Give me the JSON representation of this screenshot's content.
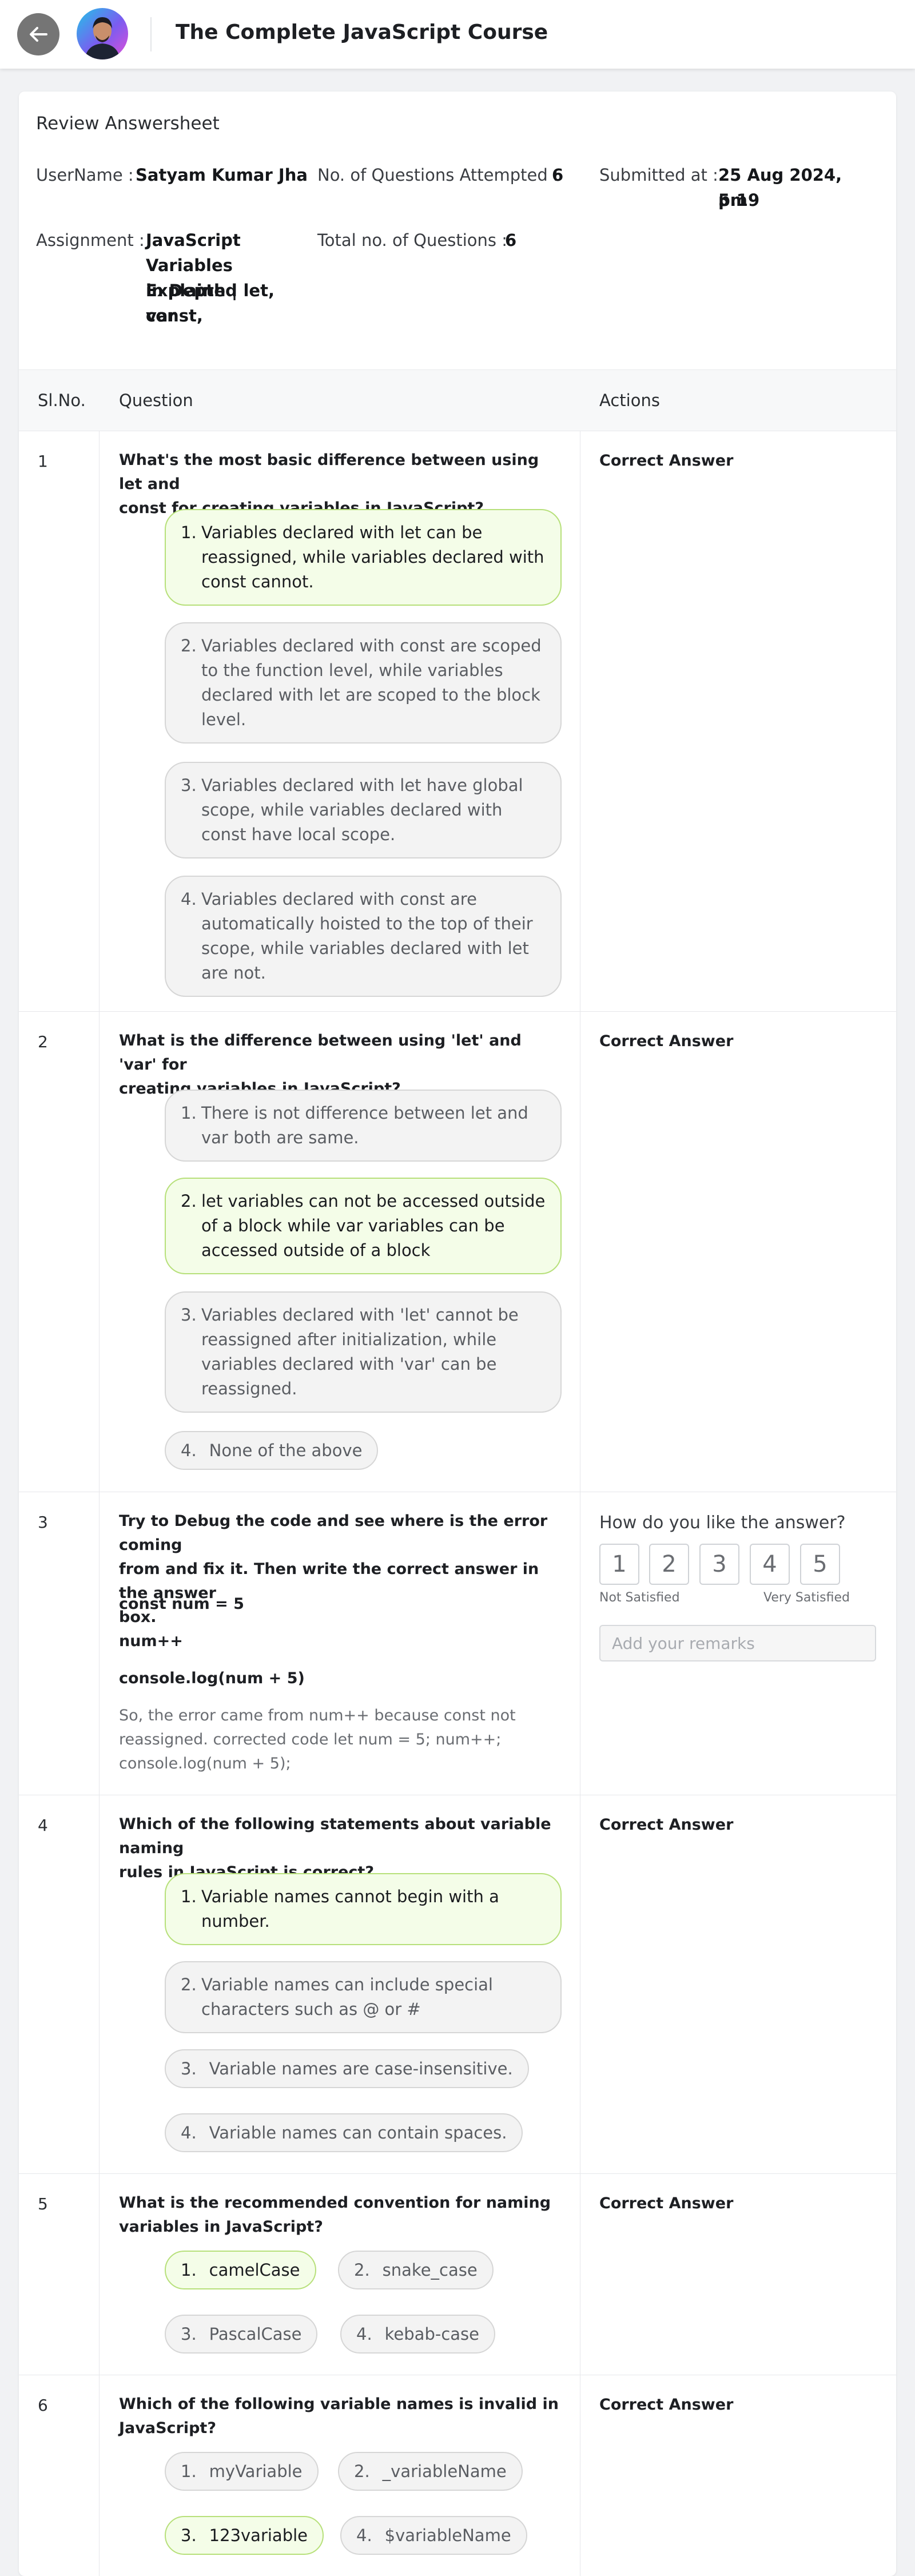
{
  "header": {
    "title": "The Complete JavaScript Course"
  },
  "review": {
    "title": "Review Answersheet",
    "username_label": "UserName :",
    "username": "Satyam Kumar Jha",
    "attempted_label": "No. of Questions Attempted :",
    "attempted": "6",
    "submitted_label": "Submitted at :",
    "submitted_line1": "25 Aug 2024, 5:19",
    "submitted_line2": "pm",
    "assignment_label": "Assignment :",
    "assignment_lines": [
      "JavaScript",
      "Variables Explained",
      "in Depth | let, const,",
      "var"
    ],
    "total_label": "Total no. of Questions :",
    "total": "6"
  },
  "table": {
    "headers": {
      "sl": "Sl.No.",
      "question": "Question",
      "actions": "Actions"
    }
  },
  "questions": [
    {
      "sl": "1",
      "lines": [
        "What's the most basic difference between using let and",
        "const for creating variables in JavaScript?"
      ],
      "action": "Correct Answer",
      "options": [
        {
          "num": "1.",
          "lines": [
            "Variables declared with let can be",
            "reassigned, while variables declared with",
            "const cannot."
          ],
          "correct": true
        },
        {
          "num": "2.",
          "lines": [
            "Variables declared with const are scoped",
            "to the function level, while variables",
            "declared with let are scoped to the block",
            "level."
          ],
          "correct": false
        },
        {
          "num": "3.",
          "lines": [
            "Variables declared with let have global",
            "scope, while variables declared with",
            "const have local scope."
          ],
          "correct": false
        },
        {
          "num": "4.",
          "lines": [
            "Variables declared with const are",
            "automatically hoisted to the top of their",
            "scope, while variables declared with let",
            "are not."
          ],
          "correct": false
        }
      ]
    },
    {
      "sl": "2",
      "lines": [
        "What is the difference between using 'let' and 'var' for",
        "creating variables in JavaScript?"
      ],
      "action": "Correct Answer",
      "options": [
        {
          "num": "1.",
          "lines": [
            "There is not difference between let and",
            "var both are same."
          ],
          "correct": false
        },
        {
          "num": "2.",
          "lines": [
            "let variables can not be accessed outside",
            "of a block while var variables can be",
            "accessed outside of a block"
          ],
          "correct": true
        },
        {
          "num": "3.",
          "lines": [
            "Variables declared with 'let' cannot be",
            "reassigned after initialization, while",
            "variables declared with 'var' can be",
            "reassigned."
          ],
          "correct": false
        },
        {
          "num": "4.",
          "lines": [
            "None of the above"
          ],
          "correct": false
        }
      ]
    },
    {
      "sl": "3",
      "lines": [
        "Try to Debug the code and see where is the error coming",
        "from and fix it. Then write the correct answer in the answer",
        "box."
      ],
      "code": [
        "const num = 5",
        "num++",
        "console.log(num + 5)"
      ],
      "answer_lines": [
        "So, the error came from num++ because const not",
        "reassigned. corrected code let num = 5; num++;",
        "console.log(num + 5);"
      ],
      "rating": {
        "title": "How do you like the answer?",
        "scale": [
          "1",
          "2",
          "3",
          "4",
          "5"
        ],
        "low": "Not Satisfied",
        "high": "Very Satisfied",
        "remarks_placeholder": "Add your remarks"
      }
    },
    {
      "sl": "4",
      "lines": [
        "Which of the following statements about variable naming",
        "rules in JavaScript is correct?"
      ],
      "action": "Correct Answer",
      "options": [
        {
          "num": "1.",
          "lines": [
            "Variable names cannot begin with a",
            "number."
          ],
          "correct": true
        },
        {
          "num": "2.",
          "lines": [
            "Variable names can include special",
            "characters such as @ or #"
          ],
          "correct": false
        },
        {
          "num": "3.",
          "lines": [
            "Variable names are case-insensitive."
          ],
          "correct": false
        },
        {
          "num": "4.",
          "lines": [
            "Variable names can contain spaces."
          ],
          "correct": false
        }
      ]
    },
    {
      "sl": "5",
      "lines": [
        "What is the recommended convention for naming",
        "variables in JavaScript?"
      ],
      "action": "Correct Answer",
      "options": [
        {
          "num": "1.",
          "text": "camelCase",
          "correct": true
        },
        {
          "num": "2.",
          "text": "snake_case",
          "correct": false
        },
        {
          "num": "3.",
          "text": "PascalCase",
          "correct": false
        },
        {
          "num": "4.",
          "text": "kebab-case",
          "correct": false
        }
      ]
    },
    {
      "sl": "6",
      "lines": [
        "Which of the following variable names is invalid in",
        "JavaScript?"
      ],
      "action": "Correct Answer",
      "options": [
        {
          "num": "1.",
          "text": "myVariable",
          "correct": false
        },
        {
          "num": "2.",
          "text": "_variableName",
          "correct": false
        },
        {
          "num": "3.",
          "text": "123variable",
          "correct": true
        },
        {
          "num": "4.",
          "text": "$variableName",
          "correct": false
        }
      ]
    }
  ]
}
